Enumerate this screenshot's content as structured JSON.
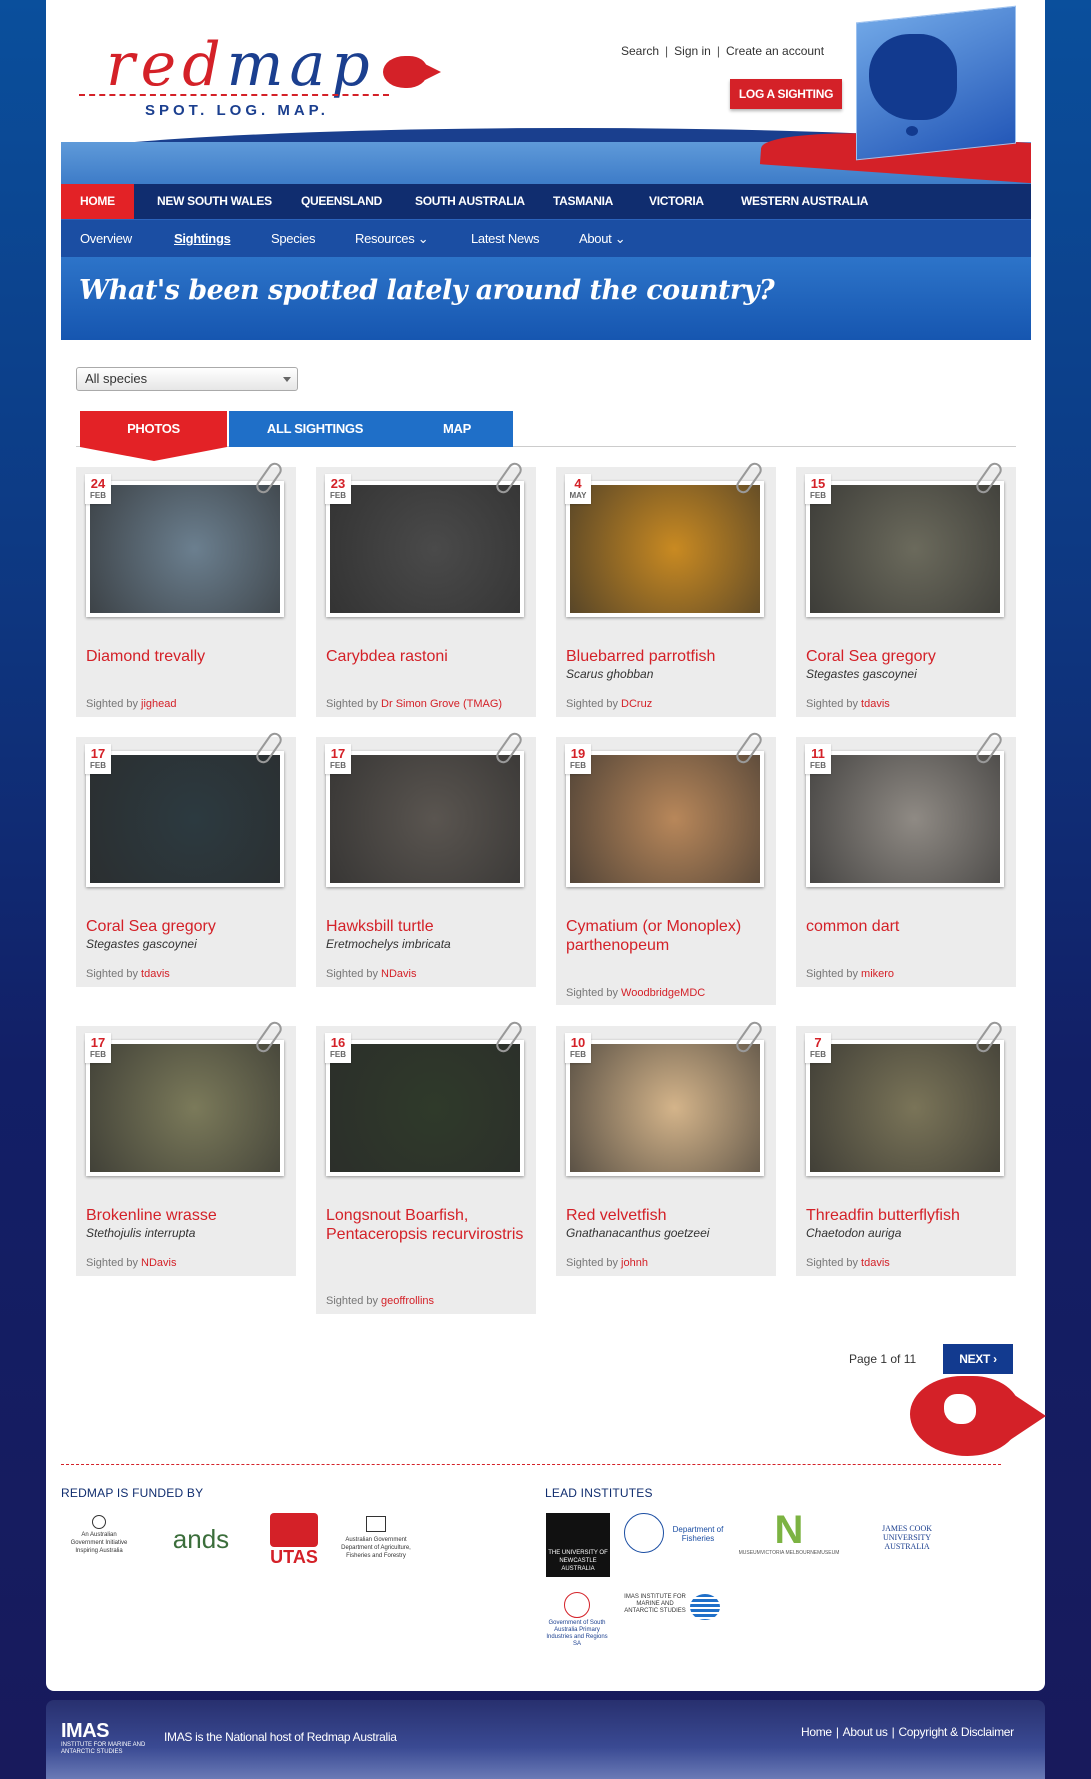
{
  "header": {
    "logo_text": "redmap",
    "tagline": "SPOT. LOG. MAP.",
    "top_links": [
      "Search",
      "Sign in",
      "Create an account"
    ],
    "log_button": "LOG A SIGHTING"
  },
  "nav_states": [
    "HOME",
    "NEW SOUTH WALES",
    "QUEENSLAND",
    "SOUTH AUSTRALIA",
    "TASMANIA",
    "VICTORIA",
    "WESTERN AUSTRALIA"
  ],
  "nav_sub": [
    "Overview",
    "Sightings",
    "Species",
    "Resources",
    "Latest News",
    "About"
  ],
  "banner_text": "What's been spotted lately around the country?",
  "filter": {
    "selected": "All species"
  },
  "tabs": [
    "PHOTOS",
    "ALL SIGHTINGS",
    "MAP"
  ],
  "cards": [
    {
      "day": "24",
      "month": "FEB",
      "name": "Diamond trevally",
      "sci": "",
      "by_label": "Sighted by",
      "user": "jighead",
      "color": "#6b7f8f"
    },
    {
      "day": "23",
      "month": "FEB",
      "name": "Carybdea rastoni",
      "sci": "",
      "by_label": "Sighted by",
      "user": "Dr Simon Grove (TMAG)",
      "color": "#4a4a4a"
    },
    {
      "day": "4",
      "month": "MAY",
      "name": "Bluebarred parrotfish",
      "sci": "Scarus ghobban",
      "by_label": "Sighted by",
      "user": "DCruz",
      "color": "#c98a22"
    },
    {
      "day": "15",
      "month": "FEB",
      "name": "Coral Sea gregory",
      "sci": "Stegastes gascoynei",
      "by_label": "Sighted by",
      "user": "tdavis",
      "color": "#6b6a5c"
    },
    {
      "day": "17",
      "month": "FEB",
      "name": "Coral Sea gregory",
      "sci": "Stegastes gascoynei",
      "by_label": "Sighted by",
      "user": "tdavis",
      "color": "#2c3a40"
    },
    {
      "day": "17",
      "month": "FEB",
      "name": "Hawksbill turtle",
      "sci": "Eretmochelys imbricata",
      "by_label": "Sighted by",
      "user": "NDavis",
      "color": "#5a5550"
    },
    {
      "day": "19",
      "month": "FEB",
      "name": "Cymatium (or Monoplex) parthenopeum",
      "sci": "",
      "by_label": "Sighted by",
      "user": "WoodbridgeMDC",
      "color": "#b8875a"
    },
    {
      "day": "11",
      "month": "FEB",
      "name": "common dart",
      "sci": "",
      "by_label": "Sighted by",
      "user": "mikero",
      "color": "#8f8a84"
    },
    {
      "day": "17",
      "month": "FEB",
      "name": "Brokenline wrasse",
      "sci": "Stethojulis interrupta",
      "by_label": "Sighted by",
      "user": "NDavis",
      "color": "#7b7a5a"
    },
    {
      "day": "16",
      "month": "FEB",
      "name": "Longsnout Boarfish, Pentaceropsis recurvirostris",
      "sci": "",
      "by_label": "Sighted by",
      "user": "geoffrollins",
      "color": "#2f3a2a"
    },
    {
      "day": "10",
      "month": "FEB",
      "name": "Red velvetfish",
      "sci": "Gnathanacanthus goetzeei",
      "by_label": "Sighted by",
      "user": "johnh",
      "color": "#d4b48a"
    },
    {
      "day": "7",
      "month": "FEB",
      "name": "Threadfin butterflyfish",
      "sci": "Chaetodon auriga",
      "by_label": "Sighted by",
      "user": "tdavis",
      "color": "#7a7458"
    }
  ],
  "pager": {
    "text": "Page 1 of 11",
    "next": "NEXT"
  },
  "footer": {
    "funded_title": "REDMAP IS FUNDED BY",
    "lead_title": "LEAD INSTITUTES",
    "funded_logos": [
      "An Australian Government Initiative Inspiring Australia",
      "ands",
      "UTAS",
      "Australian Government Department of Agriculture, Fisheries and Forestry"
    ],
    "lead_logos": [
      "THE UNIVERSITY OF NEWCASTLE AUSTRALIA",
      "Department of Fisheries",
      "MUSEUMVICTORIA MELBOURNEMUSEUM",
      "JAMES COOK UNIVERSITY AUSTRALIA",
      "Government of South Australia Primary Industries and Regions SA",
      "IMAS INSTITUTE FOR MARINE AND ANTARCTIC STUDIES"
    ]
  },
  "bottombar": {
    "logo": "IMAS",
    "logo_sub": "INSTITUTE FOR MARINE AND ANTARCTIC STUDIES",
    "host_text": "IMAS is the National host of Redmap Australia",
    "links": [
      "Home",
      "About us",
      "Copyright & Disclaimer"
    ]
  }
}
